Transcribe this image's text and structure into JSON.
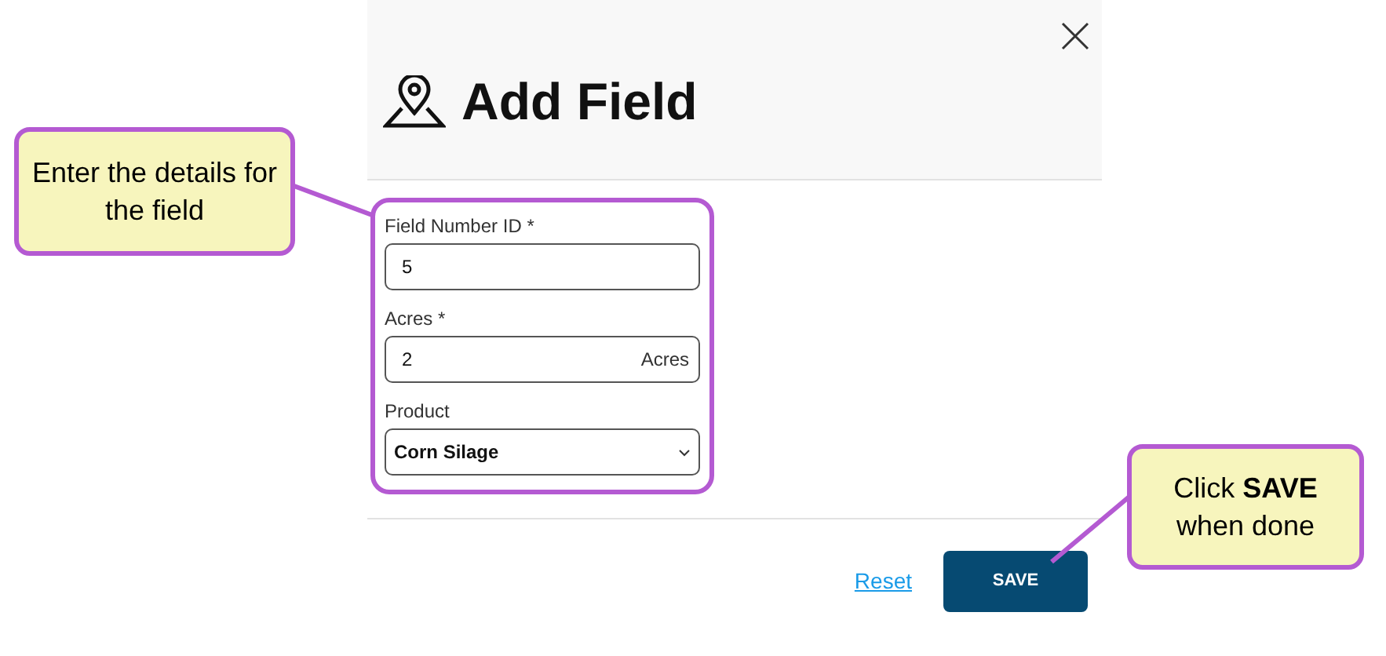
{
  "dialog": {
    "title": "Add Field",
    "fields": [
      {
        "kind": "text",
        "label": "Field Number ID *",
        "value": "5"
      },
      {
        "kind": "unit",
        "label": "Acres *",
        "value": "2",
        "unit": "Acres"
      },
      {
        "kind": "select",
        "label": "Product",
        "value": "Corn Silage"
      }
    ],
    "buttons": {
      "reset": "Reset",
      "save": "SAVE"
    }
  },
  "callouts": [
    "Enter the details for the field",
    "Click **SAVE** when done"
  ]
}
